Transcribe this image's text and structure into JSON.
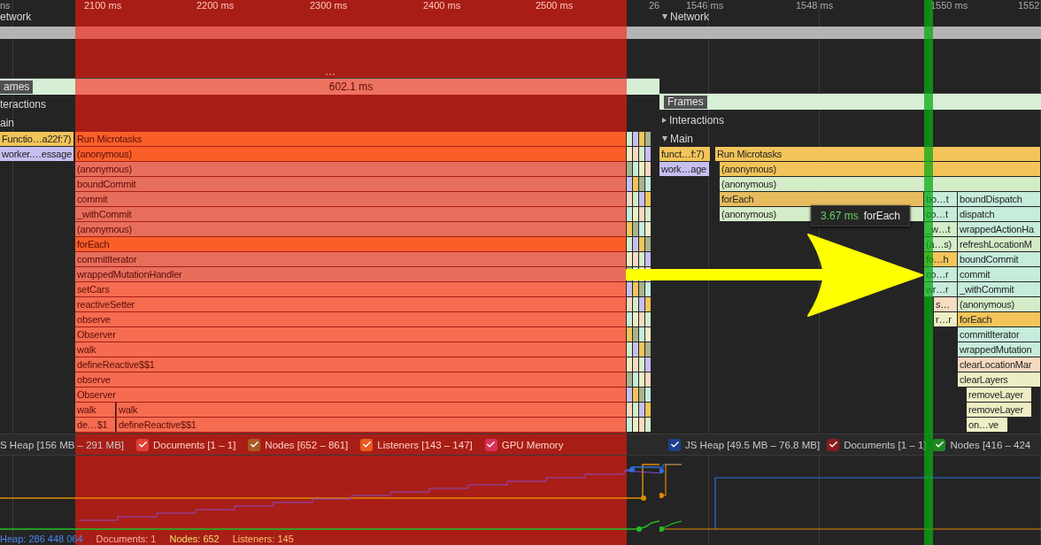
{
  "left_panel": {
    "ruler": [
      "ns",
      "2100 ms",
      "2200 ms",
      "2300 ms",
      "2400 ms",
      "2500 ms",
      "26"
    ],
    "tracks": {
      "network": "etwork",
      "frames": "ames",
      "frame_duration": "602.1 ms",
      "interactions": "teractions",
      "main": "ain"
    },
    "flame_rows": [
      [
        {
          "name": "Functio…a22f:7)",
          "color": "#f2c45a"
        },
        {
          "name": "Run Microtasks",
          "color": "#fa5f2a"
        }
      ],
      [
        {
          "name": "worker.…essage",
          "color": "#c6bff2"
        },
        {
          "name": "(anonymous)",
          "color": "#fa5f2a"
        }
      ],
      [
        {
          "name": "(anonymous)",
          "color": "#e86e5c"
        }
      ],
      [
        {
          "name": "boundCommit",
          "color": "#e86e5c"
        }
      ],
      [
        {
          "name": "commit",
          "color": "#e86e5c"
        }
      ],
      [
        {
          "name": "_withCommit",
          "color": "#e86e5c"
        }
      ],
      [
        {
          "name": "(anonymous)",
          "color": "#e86e5c"
        }
      ],
      [
        {
          "name": "forEach",
          "color": "#fa5f2a"
        }
      ],
      [
        {
          "name": "commitIterator",
          "color": "#e86e5c"
        }
      ],
      [
        {
          "name": "wrappedMutationHandler",
          "color": "#e86e5c"
        }
      ],
      [
        {
          "name": "setCars",
          "color": "#f56c50"
        }
      ],
      [
        {
          "name": "reactiveSetter",
          "color": "#f56c50"
        }
      ],
      [
        {
          "name": "observe",
          "color": "#f56c50"
        }
      ],
      [
        {
          "name": "Observer",
          "color": "#f56c50"
        }
      ],
      [
        {
          "name": "walk",
          "color": "#f56c50"
        }
      ],
      [
        {
          "name": "defineReactive$$1",
          "color": "#f56c50"
        }
      ],
      [
        {
          "name": "observe",
          "color": "#f56c50"
        }
      ],
      [
        {
          "name": "Observer",
          "color": "#f56c50"
        }
      ],
      [
        {
          "name": "walk",
          "color": "#f56c50"
        },
        {
          "name": "walk",
          "color": "#f56c50"
        }
      ],
      [
        {
          "name": "de…$1",
          "color": "#f56c50"
        },
        {
          "name": "defineReactive$$1",
          "color": "#f56c50"
        }
      ]
    ],
    "heap_label": "S Heap [156 MB – 291 MB]",
    "counters": [
      {
        "label": "Documents [1 – 1]",
        "checked": true,
        "color": "#e0403a"
      },
      {
        "label": "Nodes [652 – 861]",
        "checked": true,
        "color": "#a85a20"
      },
      {
        "label": "Listeners [143 – 147]",
        "checked": true,
        "color": "#e85a20"
      },
      {
        "label": "GPU Memory",
        "checked": true,
        "color": "#d83058"
      }
    ],
    "footer": [
      {
        "text": "Heap: 286 448 064",
        "color": "#4a86f0"
      },
      {
        "text": "Documents: 1",
        "color": "#ffb0a8"
      },
      {
        "text": "Nodes: 652",
        "color": "#f0e070"
      },
      {
        "text": "Listeners: 145",
        "color": "#ffc070"
      }
    ]
  },
  "right_panel": {
    "ruler": [
      "1546 ms",
      "1548 ms",
      "1550 ms",
      "1552"
    ],
    "tracks": {
      "network": {
        "label": "Network",
        "expanded": true
      },
      "frames": "Frames",
      "interactions": {
        "label": "Interactions",
        "expanded": false
      },
      "main": {
        "label": "Main",
        "expanded": true
      }
    },
    "flame_rows": [
      [
        {
          "name": "funct…f:7)",
          "color": "#f2c45a"
        },
        {
          "name": "Run Microtasks",
          "color": "#f2c45a"
        }
      ],
      [
        {
          "name": "work…age",
          "color": "#c6bff2"
        },
        {
          "name": "(anonymous)",
          "color": "#f2c45a"
        }
      ],
      [
        {
          "name": "(anonymous)",
          "color": "#d4ecc8"
        }
      ],
      [
        {
          "name": "forEach",
          "color": "#e8bc5e"
        },
        {
          "name": "bo…t",
          "color": "#c6ecdc"
        },
        {
          "name": "boundDispatch",
          "color": "#c6ecdc"
        }
      ],
      [
        {
          "name": "(anonymous)",
          "color": "#d4ecc8"
        },
        {
          "name": "co…t",
          "color": "#c6ecdc"
        },
        {
          "name": "dispatch",
          "color": "#c6ecdc"
        }
      ],
      [
        {
          "name": "_w…t",
          "color": "#d4ecc8"
        },
        {
          "name": "wrappedActionHa",
          "color": "#c6ecdc"
        }
      ],
      [
        {
          "name": "(a…s)",
          "color": "#d4ecc8"
        },
        {
          "name": "refreshLocationM",
          "color": "#d4ecc8"
        }
      ],
      [
        {
          "name": "fo…h",
          "color": "#f2c45a"
        },
        {
          "name": "boundCommit",
          "color": "#c6ecdc"
        }
      ],
      [
        {
          "name": "co…r",
          "color": "#c6ecdc"
        },
        {
          "name": "commit",
          "color": "#c6ecdc"
        }
      ],
      [
        {
          "name": "wr…r",
          "color": "#c6ecdc"
        },
        {
          "name": "_withCommit",
          "color": "#c6ecdc"
        }
      ],
      [
        {
          "name": "s…",
          "color": "#f6dcc0"
        },
        {
          "name": "(anonymous)",
          "color": "#d4ecc8"
        }
      ],
      [
        {
          "name": "r…r",
          "color": "#eeeec4"
        },
        {
          "name": "forEach",
          "color": "#f2c45a"
        }
      ],
      [
        {
          "name": "commitIterator",
          "color": "#c6ecdc"
        }
      ],
      [
        {
          "name": "wrappedMutation",
          "color": "#c6ecdc"
        }
      ],
      [
        {
          "name": "clearLocationMar",
          "color": "#f6d9c0"
        }
      ],
      [
        {
          "name": "clearLayers",
          "color": "#eeeec4"
        }
      ],
      [
        {
          "name": "removeLayer",
          "color": "#eeeec4"
        }
      ],
      [
        {
          "name": "removeLayer",
          "color": "#eeeec4"
        }
      ],
      [
        {
          "name": "on…ve",
          "color": "#eeeec4"
        }
      ]
    ],
    "tooltip": {
      "duration": "3.67 ms",
      "name": "forEach"
    },
    "counters": [
      {
        "label": "JS Heap [49.5 MB – 76.8 MB]",
        "checked": true,
        "color": "#1e3f8f"
      },
      {
        "label": "Documents [1 – 1]",
        "checked": true,
        "color": "#8b1c1c"
      },
      {
        "label": "Nodes [416 – 424",
        "checked": true,
        "color": "#1f8a24"
      }
    ]
  }
}
